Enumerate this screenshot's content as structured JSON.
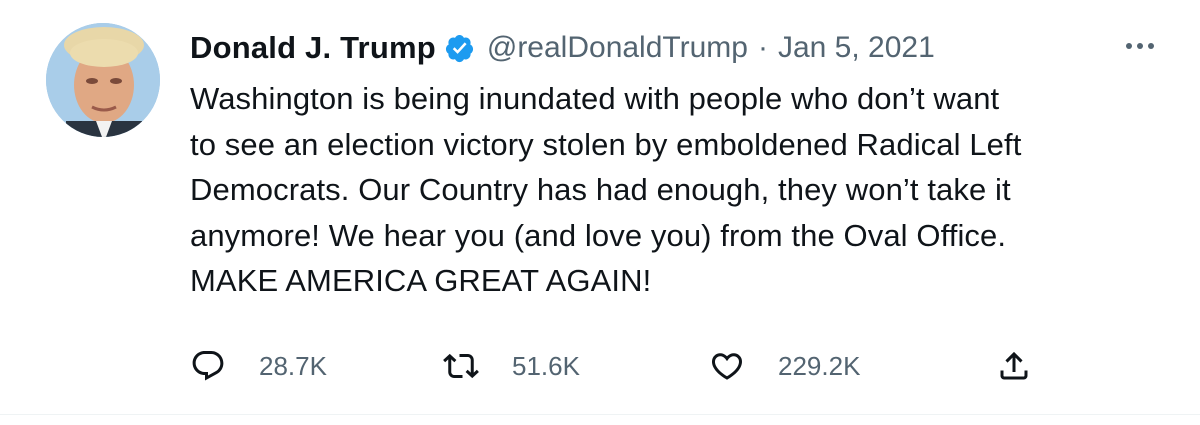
{
  "tweet": {
    "display_name": "Donald J. Trump",
    "handle": "@realDonaldTrump",
    "separator": "·",
    "date": "Jan 5, 2021",
    "text": "Washington is being inundated with people who don’t want\nto see an election victory stolen by emboldened Radical Left\nDemocrats. Our Country has had enough, they won’t take it\nanymore! We hear you (and love you) from the Oval Office.\nMAKE AMERICA GREAT AGAIN!",
    "verified": true
  },
  "actions": {
    "reply_count": "28.7K",
    "retweet_count": "51.6K",
    "like_count": "229.2K"
  },
  "icons": {
    "verified": "verified-badge-icon",
    "more": "more-options-icon",
    "reply": "reply-icon",
    "retweet": "retweet-icon",
    "like": "heart-icon",
    "share": "share-icon"
  },
  "colors": {
    "text": "#0f1419",
    "secondary": "#536471",
    "verified": "#1d9bf0"
  }
}
